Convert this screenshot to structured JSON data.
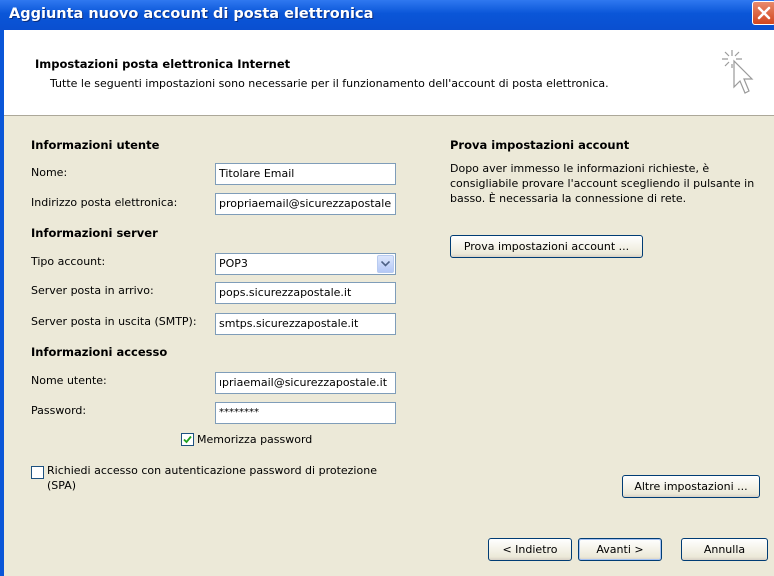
{
  "window": {
    "title": "Aggiunta nuovo account di posta elettronica"
  },
  "header": {
    "title": "Impostazioni posta elettronica Internet",
    "subtitle": "Tutte le seguenti impostazioni sono necessarie per il funzionamento dell'account di posta elettronica."
  },
  "user_info": {
    "heading": "Informazioni utente",
    "name_label": "Nome:",
    "name_value": "Titolare Email",
    "email_label": "Indirizzo posta elettronica:",
    "email_value": "propriaemail@sicurezzapostale"
  },
  "server_info": {
    "heading": "Informazioni server",
    "account_type_label": "Tipo account:",
    "account_type_value": "POP3",
    "incoming_label": "Server posta in arrivo:",
    "incoming_value": "pops.sicurezzapostale.it",
    "outgoing_label": "Server posta in uscita (SMTP):",
    "outgoing_value": "smtps.sicurezzapostale.it"
  },
  "login_info": {
    "heading": "Informazioni accesso",
    "username_label": "Nome utente:",
    "username_value": "ıpriaemail@sicurezzapostale.it",
    "password_label": "Password:",
    "password_value": "********",
    "remember_label": "Memorizza password",
    "remember_checked": true
  },
  "spa": {
    "label_line1": "Richiedi accesso con autenticazione password di protezione",
    "label_line2": "(SPA)",
    "checked": false
  },
  "test": {
    "heading": "Prova impostazioni account",
    "description_line1": "Dopo aver immesso le informazioni richieste, è",
    "description_line2": "consigliabile provare l'account scegliendo il pulsante in",
    "description_line3": "basso. È necessaria la connessione di rete.",
    "button_label": "Prova impostazioni account ..."
  },
  "buttons": {
    "more_settings": "Altre impostazioni ...",
    "back": "< Indietro",
    "next": "Avanti >",
    "cancel": "Annulla"
  }
}
